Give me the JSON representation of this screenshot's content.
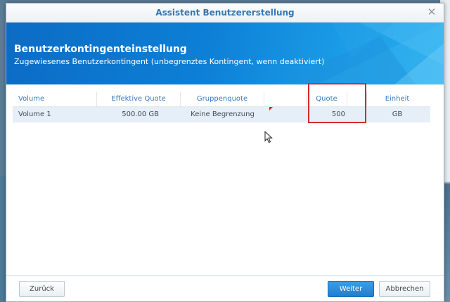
{
  "dialog": {
    "title": "Assistent Benutzererstellung",
    "close_glyph": "✕"
  },
  "banner": {
    "title": "Benutzerkontingenteinstellung",
    "subtitle": "Zugewiesenes Benutzerkontingent (unbegrenztes Kontingent, wenn deaktiviert)"
  },
  "table": {
    "columns": [
      "Volume",
      "Effektive Quote",
      "Gruppenquote",
      "",
      "Quote",
      "",
      "Einheit"
    ],
    "rows": [
      {
        "volume": "Volume 1",
        "effective_quota": "500.00 GB",
        "group_quota": "Keine Begrenzung",
        "quota": "500",
        "unit": "GB"
      }
    ]
  },
  "footer": {
    "back_label": "Zurück",
    "next_label": "Weiter",
    "cancel_label": "Abbrechen"
  },
  "colors": {
    "accent": "#3577b2",
    "banner_blue": "#0d7fd6",
    "highlight_red": "#d22b2b"
  },
  "icons": {
    "close": "close-icon",
    "cursor": "mouse-cursor-icon"
  }
}
